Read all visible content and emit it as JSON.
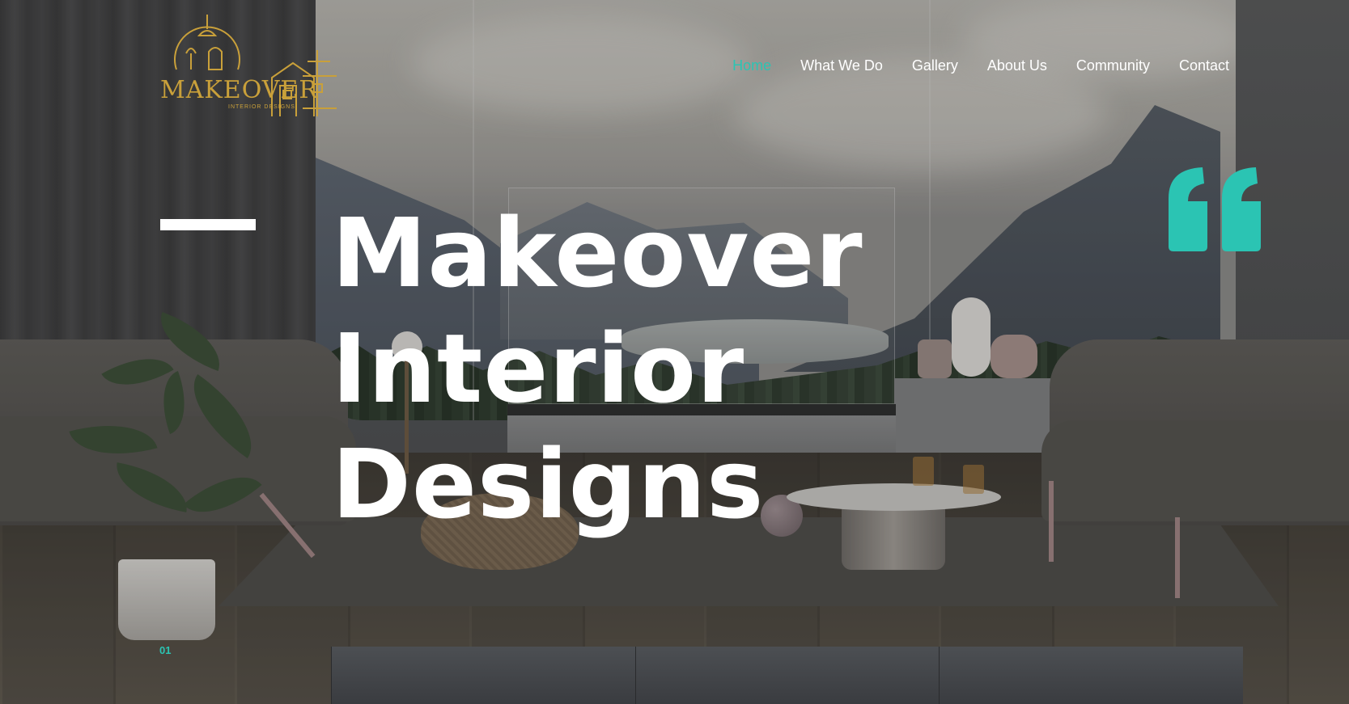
{
  "brand": {
    "logo_text": "MAKEOVER",
    "logo_subtext": "INTERIOR DESIGNS",
    "accent_color": "#2bc4b3",
    "logo_color": "#c9a03a"
  },
  "nav": {
    "items": [
      {
        "label": "Home",
        "active": true
      },
      {
        "label": "What We Do",
        "active": false
      },
      {
        "label": "Gallery",
        "active": false
      },
      {
        "label": "About Us",
        "active": false
      },
      {
        "label": "Community",
        "active": false
      },
      {
        "label": "Contact",
        "active": false
      }
    ]
  },
  "hero": {
    "title_lines": [
      "Makeover",
      "Interior",
      "Designs"
    ],
    "quote_icon": "quote-mark-icon"
  },
  "slider": {
    "current_slide": "01",
    "thumbnail_count": 3
  }
}
